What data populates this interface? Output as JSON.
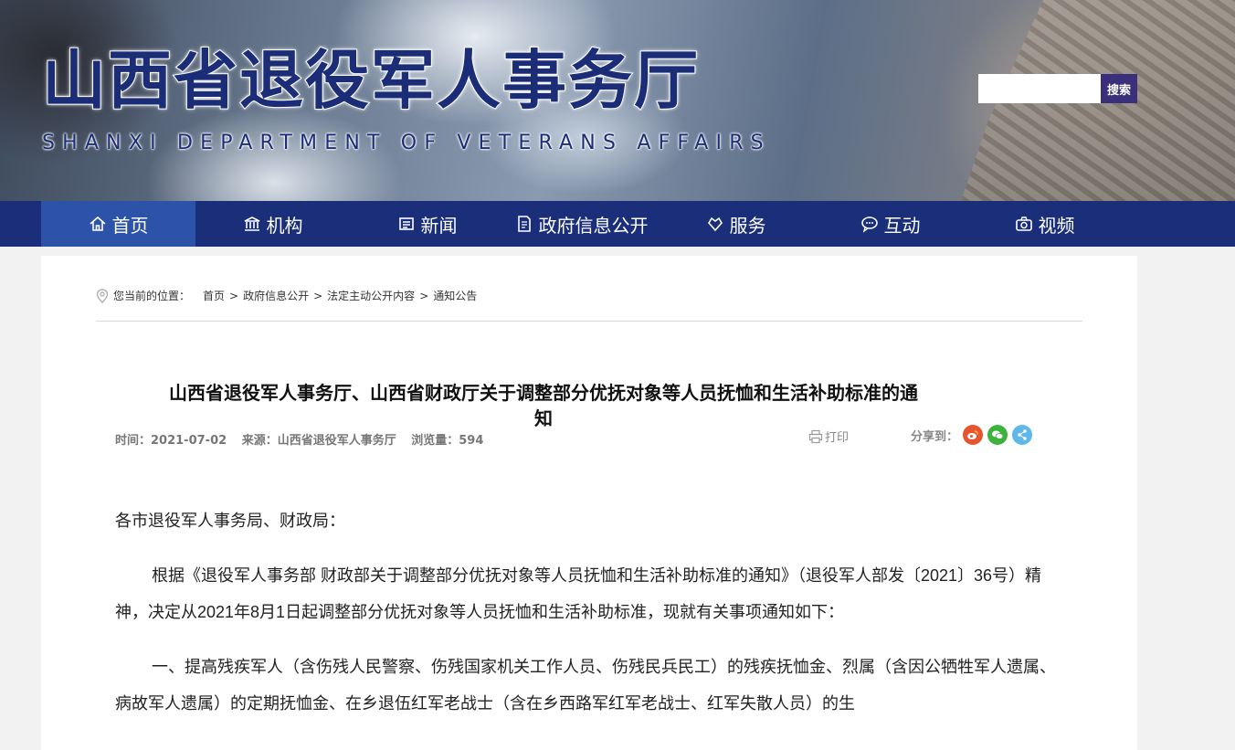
{
  "header": {
    "title": "山西省退役军人事务厅",
    "subtitle": "SHANXI DEPARTMENT OF VETERANS AFFAIRS",
    "search_placeholder": "",
    "search_button": "搜索"
  },
  "nav": {
    "items": [
      {
        "label": "首页",
        "icon": "home-icon",
        "active": true
      },
      {
        "label": "机构",
        "icon": "institution-icon"
      },
      {
        "label": "新闻",
        "icon": "news-icon"
      },
      {
        "label": "政府信息公开",
        "icon": "document-icon"
      },
      {
        "label": "服务",
        "icon": "service-icon"
      },
      {
        "label": "互动",
        "icon": "chat-icon"
      },
      {
        "label": "视频",
        "icon": "camera-icon"
      }
    ]
  },
  "breadcrumb": {
    "label": "您当前的位置：",
    "items": [
      "首页",
      "政府信息公开",
      "法定主动公开内容",
      "通知公告"
    ],
    "separator": ">"
  },
  "article": {
    "title": "山西省退役军人事务厅、山西省财政厅关于调整部分优抚对象等人员抚恤和生活补助标准的通知",
    "time": "时间：2021-07-02",
    "source": "来源：山西省退役军人事务厅",
    "views": "浏览量：594",
    "print_label": "打印",
    "share_label": "分享到：",
    "paragraphs": [
      "各市退役军人事务局、财政局：",
      "根据《退役军人事务部 财政部关于调整部分优抚对象等人员抚恤和生活补助标准的通知》（退役军人部发〔2021〕36号）精神，决定从2021年8月1日起调整部分优抚对象等人员抚恤和生活补助标准，现就有关事项通知如下：",
      "一、提高残疾军人（含伤残人民警察、伤残国家机关工作人员、伤残民兵民工）的残疾抚恤金、烈属（含因公牺牲军人遗属、病故军人遗属）的定期抚恤金、在乡退伍红军老战士（含在乡西路军红军老战士、红军失散人员）的生"
    ]
  },
  "colors": {
    "nav_bg": "#1a2e7a",
    "nav_active": "#2c53a8",
    "title_blue": "#1c2d78",
    "weibo": "#e8542e",
    "wechat": "#3db23d",
    "share": "#5fb8e8"
  }
}
